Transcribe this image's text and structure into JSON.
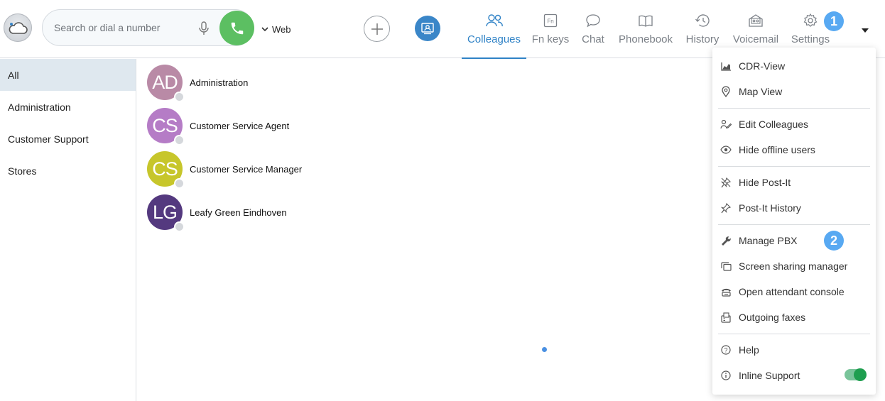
{
  "search": {
    "placeholder": "Search or dial a number"
  },
  "source_selector": {
    "label": "Web"
  },
  "nav": {
    "tabs": [
      {
        "label": "Colleagues",
        "icon": "users-icon",
        "active": true
      },
      {
        "label": "Fn keys",
        "icon": "fn-key-icon",
        "active": false
      },
      {
        "label": "Chat",
        "icon": "chat-bubble-icon",
        "active": false
      },
      {
        "label": "Phonebook",
        "icon": "book-icon",
        "active": false
      },
      {
        "label": "History",
        "icon": "history-clock-icon",
        "active": false
      },
      {
        "label": "Voicemail",
        "icon": "voicemail-icon",
        "active": false
      },
      {
        "label": "Settings",
        "icon": "gear-icon",
        "active": false
      }
    ]
  },
  "badges": {
    "one": "1",
    "two": "2"
  },
  "sidebar": {
    "items": [
      {
        "label": "All",
        "active": true
      },
      {
        "label": "Administration",
        "active": false
      },
      {
        "label": "Customer Support",
        "active": false
      },
      {
        "label": "Stores",
        "active": false
      }
    ]
  },
  "colleagues": [
    {
      "initials": "AD",
      "name": "Administration",
      "color": "#b98aa6"
    },
    {
      "initials": "CS",
      "name": "Customer Service Agent",
      "color": "#b57cc6"
    },
    {
      "initials": "CS",
      "name": "Customer Service Manager",
      "color": "#c7c62b"
    },
    {
      "initials": "LG",
      "name": "Leafy Green Eindhoven",
      "color": "#54397f"
    }
  ],
  "menu": {
    "items": [
      {
        "label": "CDR-View",
        "icon": "chart-area-icon"
      },
      {
        "label": "Map View",
        "icon": "map-pin-icon"
      },
      {
        "label": "Edit Colleagues",
        "icon": "edit-user-icon"
      },
      {
        "label": "Hide offline users",
        "icon": "eye-icon"
      },
      {
        "label": "Hide Post-It",
        "icon": "pin-off-icon"
      },
      {
        "label": "Post-It History",
        "icon": "pin-icon"
      },
      {
        "label": "Manage PBX",
        "icon": "wrench-icon"
      },
      {
        "label": "Screen sharing manager",
        "icon": "screens-icon"
      },
      {
        "label": "Open attendant console",
        "icon": "phone-console-icon"
      },
      {
        "label": "Outgoing faxes",
        "icon": "fax-icon"
      },
      {
        "label": "Help",
        "icon": "help-circle-icon"
      },
      {
        "label": "Inline Support",
        "icon": "info-circle-icon",
        "toggle": true
      }
    ]
  },
  "colors": {
    "accent": "#2f82c6",
    "call_green": "#5cbf62",
    "badge_blue": "#58a9f2",
    "toggle_green": "#1e9e4f"
  }
}
